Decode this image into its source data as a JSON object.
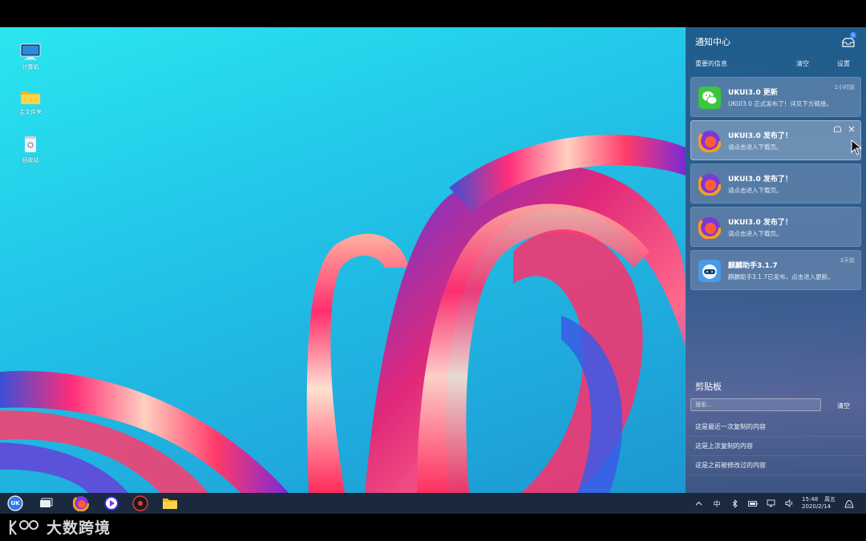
{
  "desktop": {
    "icons": [
      {
        "label": "计算机",
        "icon": "computer-icon"
      },
      {
        "label": "主文件夹",
        "icon": "home-folder-icon"
      },
      {
        "label": "回收站",
        "icon": "trash-icon"
      }
    ]
  },
  "notification_center": {
    "title": "通知中心",
    "badge_count": "1",
    "important_label": "重要的信息",
    "clear_label": "清空",
    "settings_label": "设置",
    "notifications": [
      {
        "app": "wechat",
        "title": "UKUI3.0 更新",
        "body": "UKUI3.0 正式发布了！详见下方链接。",
        "time": "1小时前"
      },
      {
        "app": "firefox",
        "title": "UKUI3.0 发布了！",
        "body": "请点击进入下载页。",
        "time": ""
      },
      {
        "app": "firefox",
        "title": "UKUI3.0 发布了！",
        "body": "请点击进入下载页。",
        "time": ""
      },
      {
        "app": "firefox",
        "title": "UKUI3.0 发布了！",
        "body": "请点击进入下载页。",
        "time": ""
      },
      {
        "app": "kylin-assistant",
        "title": "麒麟助手3.1.7",
        "body": "麒麟助手3.1.7已发布，点击进入更新。",
        "time": "3天前"
      }
    ]
  },
  "clipboard": {
    "title": "剪贴板",
    "search_placeholder": "搜索...",
    "clear_label": "清空",
    "items": [
      "这是最近一次复制的内容",
      "这是上次复制的内容",
      "这是之前被修改过的内容"
    ]
  },
  "taskbar": {
    "start_label": "UK",
    "apps": [
      "start-menu-icon",
      "multitask-view-icon",
      "firefox-icon",
      "media-player-icon",
      "music-player-icon",
      "file-manager-icon"
    ],
    "tray": {
      "input_method": "中"
    },
    "clock": {
      "time": "15:48",
      "weekday": "周五",
      "date": "2020/2/14"
    }
  },
  "watermark": {
    "text": "大数跨境"
  },
  "colors": {
    "accent": "#1fa9dc",
    "panel": "#2a4a7a",
    "taskbar": "#1c2c42"
  }
}
